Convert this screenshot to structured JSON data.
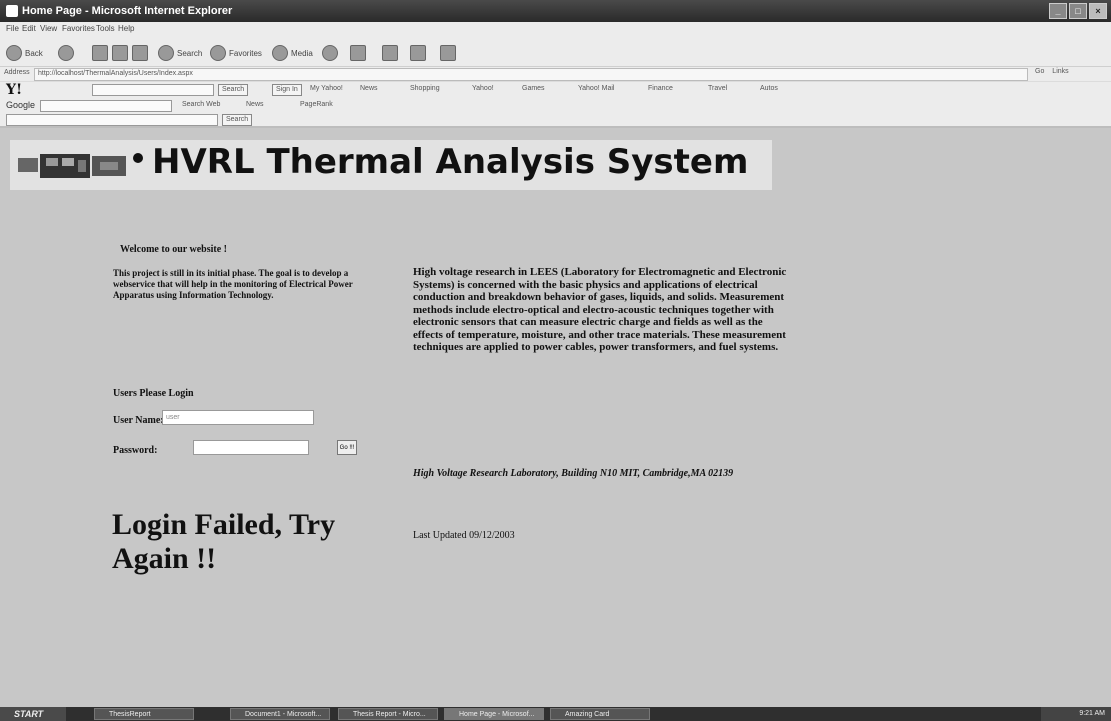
{
  "window": {
    "title": "Home Page - Microsoft Internet Explorer"
  },
  "menu": [
    "File",
    "Edit",
    "View",
    "Favorites",
    "Tools",
    "Help"
  ],
  "toolbar": {
    "back": "Back",
    "search": "Search",
    "favorites": "Favorites",
    "media": "Media"
  },
  "address": {
    "label": "Address",
    "url": "http://localhost/ThermalAnalysis/Users/Index.aspx",
    "go": "Go",
    "links": "Links"
  },
  "yahoo_bar": {
    "logo": "Y!",
    "search_btn": "Search",
    "sign_in": "Sign In",
    "items": [
      "My Yahoo!",
      "News",
      "Shopping",
      "Yahoo!",
      "Games",
      "Yahoo! Mail",
      "Finance",
      "Travel",
      "Autos"
    ]
  },
  "google_bar": {
    "logo": "Google",
    "search_web": "Search Web",
    "news": "News",
    "options": "PageRank"
  },
  "search_bar": {
    "search_btn": "Search"
  },
  "page": {
    "banner_title": "HVRL Thermal Analysis System",
    "welcome": "Welcome to our website !",
    "intro": "This project is still in its initial phase. The goal is to develop a webservice that will help in the monitoring of Electrical Power Apparatus using Information Technology.",
    "description": "High voltage research in LEES (Laboratory for Electromagnetic and Electronic Systems) is concerned with the basic physics and applications of electrical conduction and breakdown behavior of gases, liquids, and solids. Measurement methods include electro-optical and electro-acoustic techniques together with electronic sensors that can measure electric charge and fields as well as the effects of temperature, moisture, and other trace materials. These measurement techniques are applied to power cables, power transformers, and fuel systems.",
    "login_title": "Users Please Login",
    "username_label": "User Name:",
    "username_value": "user",
    "password_label": "Password:",
    "go_label": "Go !!!",
    "failed_message": "Login Failed, Try Again !!",
    "address_text": "High Voltage Research Laboratory, Building N10 MIT, Cambridge,MA 02139",
    "last_updated": "Last Updated 09/12/2003"
  },
  "taskbar": {
    "start": "START",
    "tasks": [
      "ThesisReport",
      "Document1 - Microsoft...",
      "Thesis Report - Micro...",
      "Home Page - Microsof...",
      "Amazing Card"
    ],
    "clock": "9:21 AM"
  }
}
